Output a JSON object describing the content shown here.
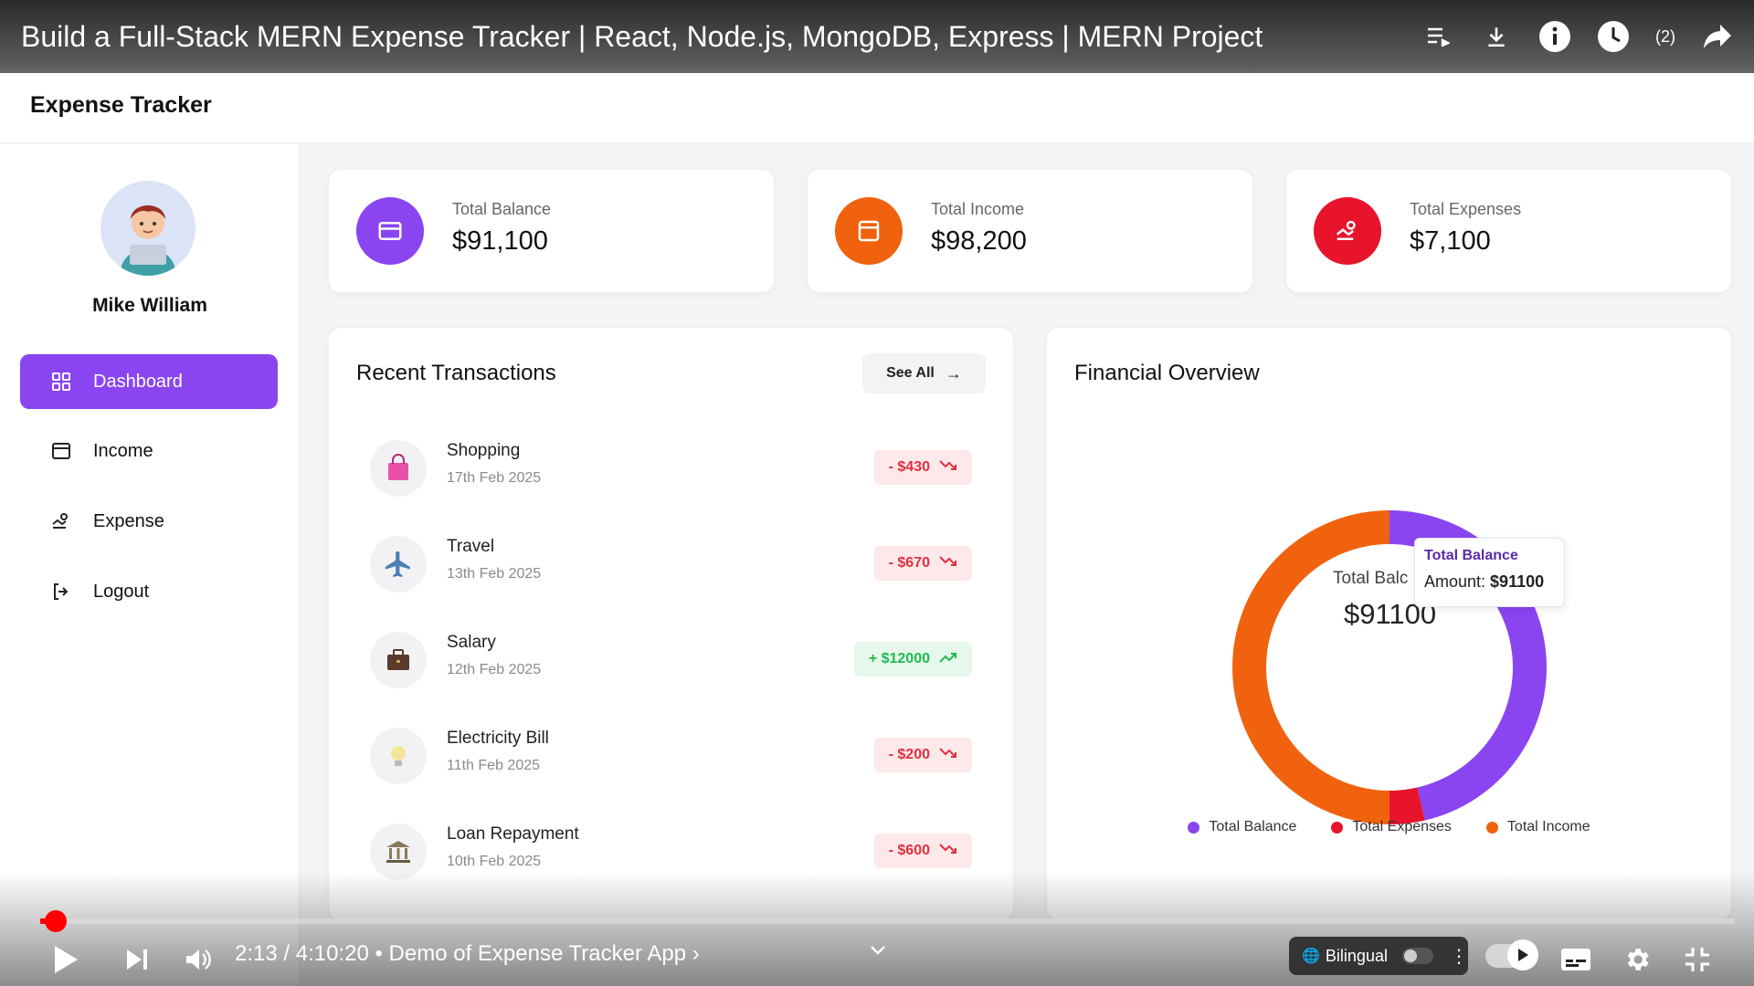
{
  "video": {
    "title": "Build a Full-Stack MERN Expense Tracker | React, Node.js, MongoDB, Express | MERN Project",
    "time": "2:13 / 4:10:20",
    "chapter": " • Demo of Expense Tracker App ›",
    "progress_fraction": 0.0089,
    "bilingual_label": "Bilingual",
    "playlist_count": "(2)",
    "top_icons": [
      "queue-icon",
      "download-icon",
      "info-icon",
      "watch-later-icon",
      "share-icon",
      "more-icon"
    ]
  },
  "app": {
    "title": "Expense Tracker",
    "user_name": "Mike William",
    "nav": [
      {
        "label": "Dashboard",
        "icon": "grid-icon",
        "active": true
      },
      {
        "label": "Income",
        "icon": "wallet-icon",
        "active": false
      },
      {
        "label": "Expense",
        "icon": "hand-coin-icon",
        "active": false
      },
      {
        "label": "Logout",
        "icon": "logout-icon",
        "active": false
      }
    ]
  },
  "stats": [
    {
      "label": "Total Balance",
      "value": "$91,100",
      "color": "#8a45f0"
    },
    {
      "label": "Total Income",
      "value": "$98,200",
      "color": "#f0620e"
    },
    {
      "label": "Total Expenses",
      "value": "$7,100",
      "color": "#e8142c"
    }
  ],
  "transactions": {
    "title": "Recent Transactions",
    "see_all": "See All",
    "items": [
      {
        "name": "Shopping",
        "date": "17th Feb 2025",
        "amount": "- $430",
        "type": "neg",
        "icon": "shopping-bag-icon"
      },
      {
        "name": "Travel",
        "date": "13th Feb 2025",
        "amount": "- $670",
        "type": "neg",
        "icon": "airplane-icon"
      },
      {
        "name": "Salary",
        "date": "12th Feb 2025",
        "amount": "+ $12000",
        "type": "pos",
        "icon": "briefcase-icon"
      },
      {
        "name": "Electricity Bill",
        "date": "11th Feb 2025",
        "amount": "- $200",
        "type": "neg",
        "icon": "lightbulb-icon"
      },
      {
        "name": "Loan Repayment",
        "date": "10th Feb 2025",
        "amount": "- $600",
        "type": "neg",
        "icon": "bank-icon"
      }
    ]
  },
  "overview": {
    "title": "Financial Overview",
    "center_label": "Total Balc",
    "center_value": "$91100",
    "tooltip_title": "Total Balance",
    "tooltip_prefix": "Amount: ",
    "tooltip_value": "$91100",
    "legend": [
      {
        "label": "Total Balance",
        "color": "#8a45f0"
      },
      {
        "label": "Total Expenses",
        "color": "#e8142c"
      },
      {
        "label": "Total Income",
        "color": "#f0620e"
      }
    ]
  },
  "chart_data": {
    "type": "pie",
    "categories": [
      "Total Balance",
      "Total Expenses",
      "Total Income"
    ],
    "values": [
      91100,
      7100,
      98200
    ],
    "colors": [
      "#8a45f0",
      "#e8142c",
      "#f0620e"
    ]
  }
}
